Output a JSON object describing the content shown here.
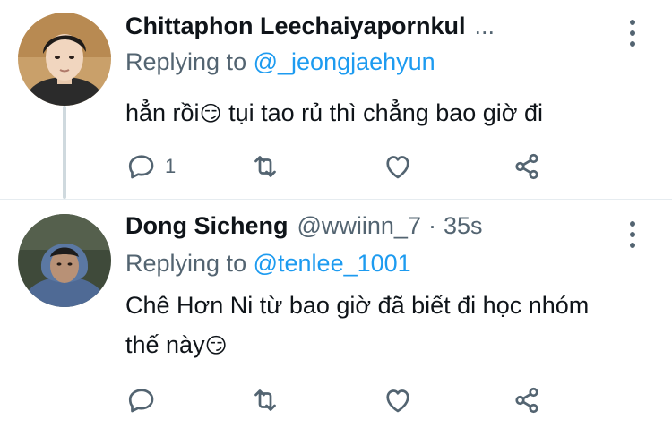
{
  "tweets": [
    {
      "name": "Chittaphon Leechaiyapornkul",
      "name_overflow": "...",
      "handle": "",
      "time": "",
      "replying_label": "Replying to",
      "replying_to": "@_jeongjaehyun",
      "text": "hẳn rồi",
      "emoji": "😏",
      "text_after_emoji": " tụi tao rủ thì chẳng bao giờ đi",
      "reply_count": "1",
      "icons": [
        "reply-icon",
        "retweet-icon",
        "like-icon",
        "share-icon",
        "more-icon"
      ]
    },
    {
      "name": "Dong Sicheng",
      "handle": "@wwiinn_7",
      "separator": "·",
      "time": "35s",
      "replying_label": "Replying to",
      "replying_to": "@tenlee_1001",
      "text": "Chê Hơn Ni từ bao giờ đã biết đi học nhóm thế này",
      "emoji": "😏",
      "reply_count": "",
      "icons": [
        "reply-icon",
        "retweet-icon",
        "like-icon",
        "share-icon",
        "more-icon"
      ]
    }
  ],
  "colors": {
    "primary_text": "#0f1419",
    "secondary_text": "#536471",
    "mention": "#1d9bf0",
    "thread_line": "#cfd9de"
  }
}
